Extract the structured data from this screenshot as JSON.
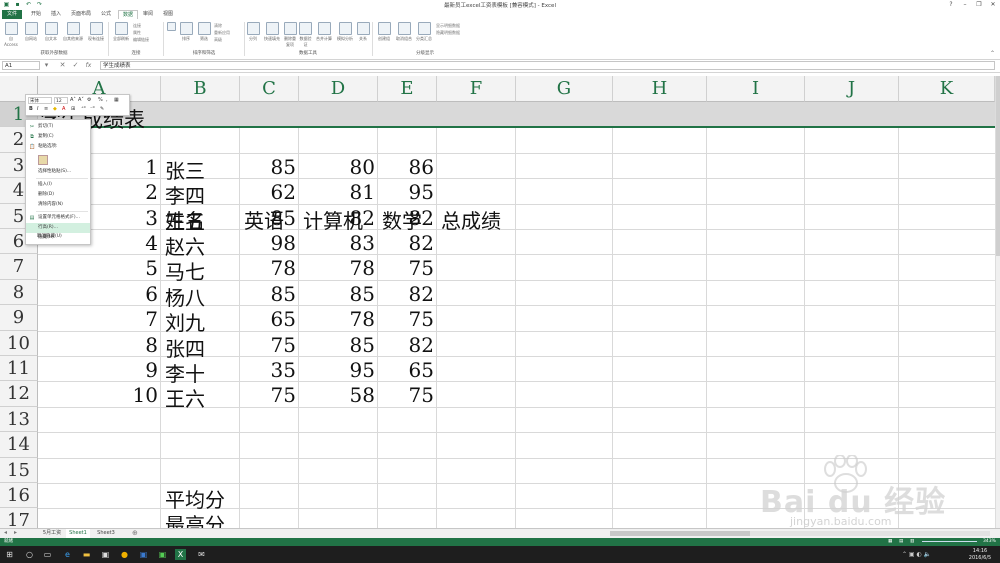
{
  "window": {
    "title": "最新员工excel工资表模板 [兼容模式] - Excel"
  },
  "ribbon": {
    "tabs": [
      "文件",
      "开始",
      "插入",
      "页面布局",
      "公式",
      "数据",
      "审阅",
      "视图"
    ],
    "active_tab": "数据",
    "groups": [
      "获取外部数据",
      "连接",
      "排序和筛选",
      "数据工具",
      "分级显示"
    ],
    "buttons": {
      "access": "自 Access",
      "web": "自网站",
      "text": "自文本",
      "other": "自其他来源",
      "existing": "现有连接",
      "refresh_all": "全部刷新",
      "connections": "连接",
      "properties": "属性",
      "edit_links": "编辑链接",
      "sort_asc": "",
      "sort": "排序",
      "filter": "筛选",
      "clear": "清除",
      "reapply": "重新应用",
      "advanced": "高级",
      "text_to_col": "分列",
      "flash_fill": "快速填充",
      "remove_dup": "删除重复项",
      "validation": "数据验证",
      "consolidate": "合并计算",
      "whatif": "模拟分析",
      "relations": "关系",
      "group": "创建组",
      "ungroup": "取消组合",
      "subtotal": "分类汇总",
      "show_detail": "显示明细数据",
      "hide_detail": "隐藏明细数据"
    }
  },
  "formula_bar": {
    "name_box": "A1",
    "fx": "fx",
    "content": "学生成绩表"
  },
  "grid": {
    "columns": [
      "A",
      "B",
      "C",
      "D",
      "E",
      "F",
      "G",
      "H",
      "I",
      "J",
      "K"
    ],
    "rows": [
      "1",
      "2",
      "3",
      "4",
      "5",
      "6",
      "7",
      "8",
      "9",
      "10",
      "11",
      "12",
      "13",
      "14",
      "15",
      "16",
      "17"
    ],
    "title": "学生成绩表",
    "headers": [
      "姓名",
      "英语",
      "计算机",
      "数学",
      "总成绩"
    ],
    "records": [
      [
        "1",
        "张三",
        "85",
        "80",
        "86"
      ],
      [
        "2",
        "李四",
        "62",
        "81",
        "95"
      ],
      [
        "3",
        "王五",
        "85",
        "82",
        "82"
      ],
      [
        "4",
        "赵六",
        "98",
        "83",
        "82"
      ],
      [
        "5",
        "马七",
        "78",
        "78",
        "75"
      ],
      [
        "6",
        "杨八",
        "85",
        "85",
        "82"
      ],
      [
        "7",
        "刘九",
        "65",
        "78",
        "75"
      ],
      [
        "8",
        "张四",
        "75",
        "85",
        "82"
      ],
      [
        "9",
        "李十",
        "35",
        "95",
        "65"
      ],
      [
        "10",
        "王六",
        "75",
        "58",
        "75"
      ]
    ],
    "footer_labels": [
      "平均分",
      "最高分"
    ]
  },
  "mini_toolbar": {
    "font": "宋体",
    "size": "12",
    "percent": "%"
  },
  "context_menu": {
    "items": [
      "剪切(T)",
      "复制(C)",
      "粘贴选项:",
      "",
      "选择性粘贴(S)...",
      "插入(I)",
      "删除(D)",
      "清除内容(N)",
      "设置单元格格式(F)...",
      "行高(R)...",
      "隐藏(H)",
      "取消隐藏(U)"
    ],
    "highlighted_index": 9
  },
  "sheets": {
    "tabs": [
      "5月工资",
      "Sheet1",
      "Sheet3"
    ],
    "active_index": 1
  },
  "status": {
    "left": "就绪",
    "zoom": "343%"
  },
  "taskbar": {
    "time": "14:16",
    "date": "2016/6/5"
  },
  "watermark": {
    "brand": "Bai du 经验",
    "url": "jingyan.baidu.com"
  },
  "colors": {
    "excel_green": "#217346",
    "menu_highlight": "#d3f0e0"
  }
}
